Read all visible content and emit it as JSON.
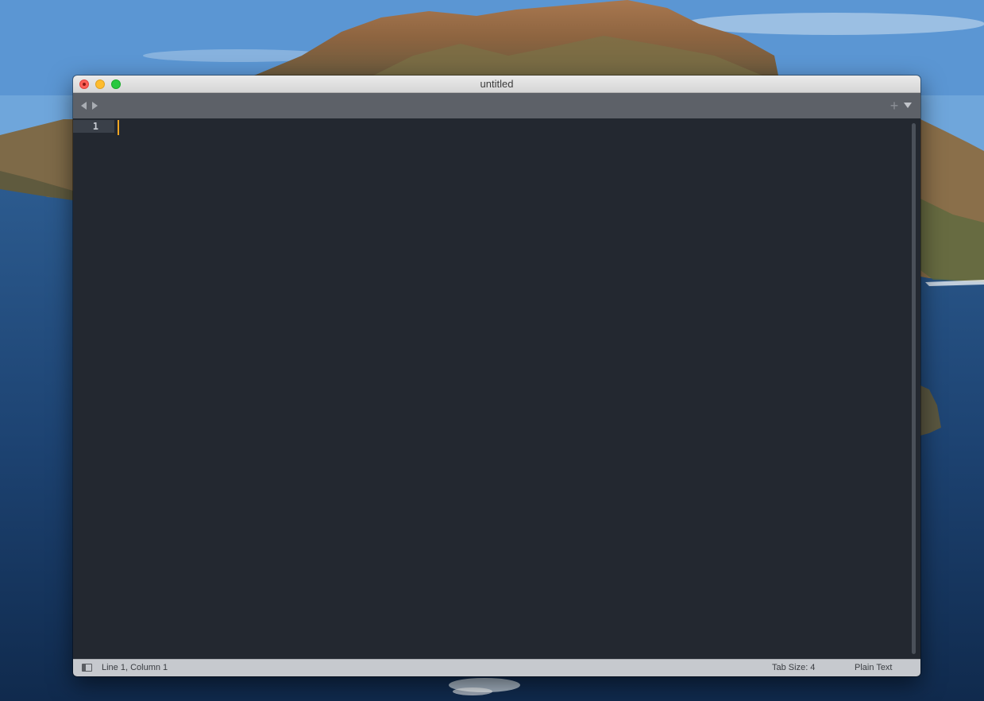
{
  "window": {
    "title": "untitled"
  },
  "tabbar": {
    "back_icon": "triangle-left-icon",
    "forward_icon": "triangle-right-icon",
    "new_tab_label": "+",
    "menu_icon": "triangle-down-icon"
  },
  "editor": {
    "lines": [
      "1"
    ],
    "caret_color": "#f5a623",
    "background_color": "#232830"
  },
  "statusbar": {
    "cursor_position": "Line 1, Column 1",
    "tab_size": "Tab Size: 4",
    "syntax": "Plain Text"
  },
  "colors": {
    "close": "#fe5f57",
    "minimize": "#febc2e",
    "maximize": "#28c840",
    "tabbar": "#5d6168",
    "statusbar": "#c6c9ce"
  }
}
